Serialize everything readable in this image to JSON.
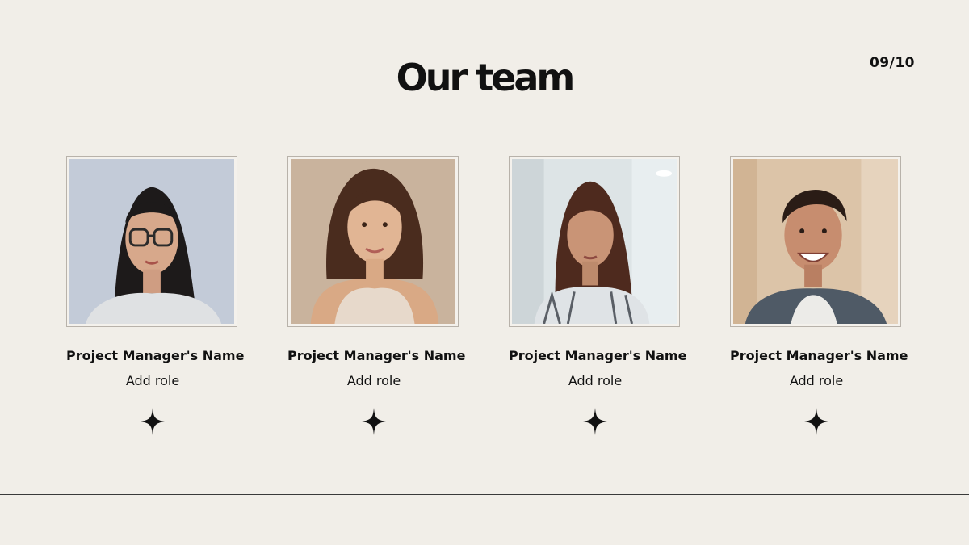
{
  "slide": {
    "title": "Our team",
    "page_number": "09/10"
  },
  "members": [
    {
      "name": "Project Manager's Name",
      "role": "Add role",
      "photo": "portrait-woman-glasses"
    },
    {
      "name": "Project Manager's Name",
      "role": "Add role",
      "photo": "portrait-woman-smiling"
    },
    {
      "name": "Project Manager's Name",
      "role": "Add role",
      "photo": "portrait-woman-office"
    },
    {
      "name": "Project Manager's Name",
      "role": "Add role",
      "photo": "portrait-man-smiling"
    }
  ],
  "decorations": {
    "star_icon": "four-point-star-icon",
    "colors": {
      "background": "#f1eee8",
      "text": "#111111",
      "rule": "#3a3a3a"
    }
  }
}
